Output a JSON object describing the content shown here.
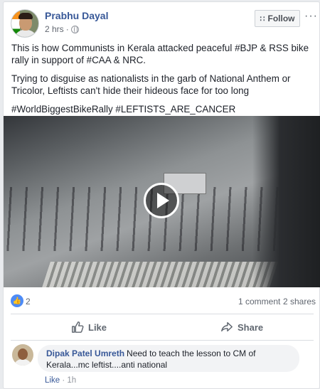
{
  "post": {
    "author": "Prabhu Dayal",
    "time": "2 hrs",
    "privacy_icon": "globe-icon",
    "follow_label": "Follow",
    "more_label": "···",
    "text_lines": [
      "This is how Communists in Kerala attacked peaceful #BJP & RSS bike rally in support of #CAA & NRC.",
      "Trying to disguise as nationalists in the garb of National Anthem or Tricolor, Leftists can't hide their hideous face for too long",
      "#WorldBiggestBikeRally #LEFTISTS_ARE_CANCER"
    ],
    "video": {
      "play_icon": "play-icon"
    }
  },
  "stats": {
    "reaction_icon": "like-reaction-icon",
    "likes": "2",
    "comments": "1 comment",
    "shares": "2 shares"
  },
  "actions": {
    "like_label": "Like",
    "share_label": "Share"
  },
  "comment": {
    "author": "Dipak Patel Umreth",
    "text": "Need to teach the lesson to CM of Kerala...mc leftist....anti national",
    "like_label": "Like",
    "separator": "·",
    "time": "1h"
  },
  "colors": {
    "link": "#385898",
    "like_blue": "#4d8bf6",
    "muted": "#616770"
  }
}
